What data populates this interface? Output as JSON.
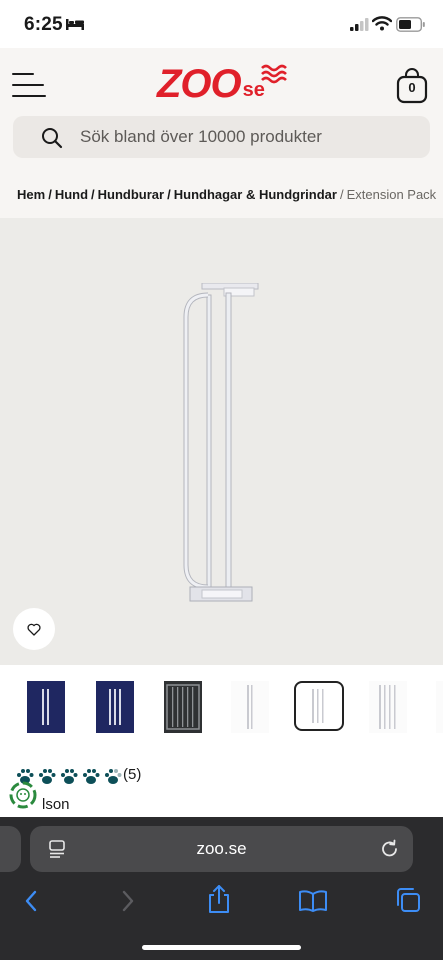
{
  "status_bar": {
    "time": "6:25",
    "icons": [
      "bed-icon",
      "signal-icon",
      "wifi-icon",
      "battery-icon"
    ]
  },
  "header": {
    "logo_main": "ZOO",
    "logo_suffix": "se",
    "cart_count": "0",
    "brand_color": "#e0202a"
  },
  "search": {
    "placeholder": "Sök bland över 10000 produkter"
  },
  "breadcrumb": {
    "items": [
      "Hem",
      "Hund",
      "Hundburar",
      "Hundhagar & Hundgrindar"
    ],
    "current": "Extension Pack"
  },
  "product": {
    "rating_count": "(5)",
    "seller": "lson"
  },
  "browser": {
    "url": "zoo.se"
  }
}
